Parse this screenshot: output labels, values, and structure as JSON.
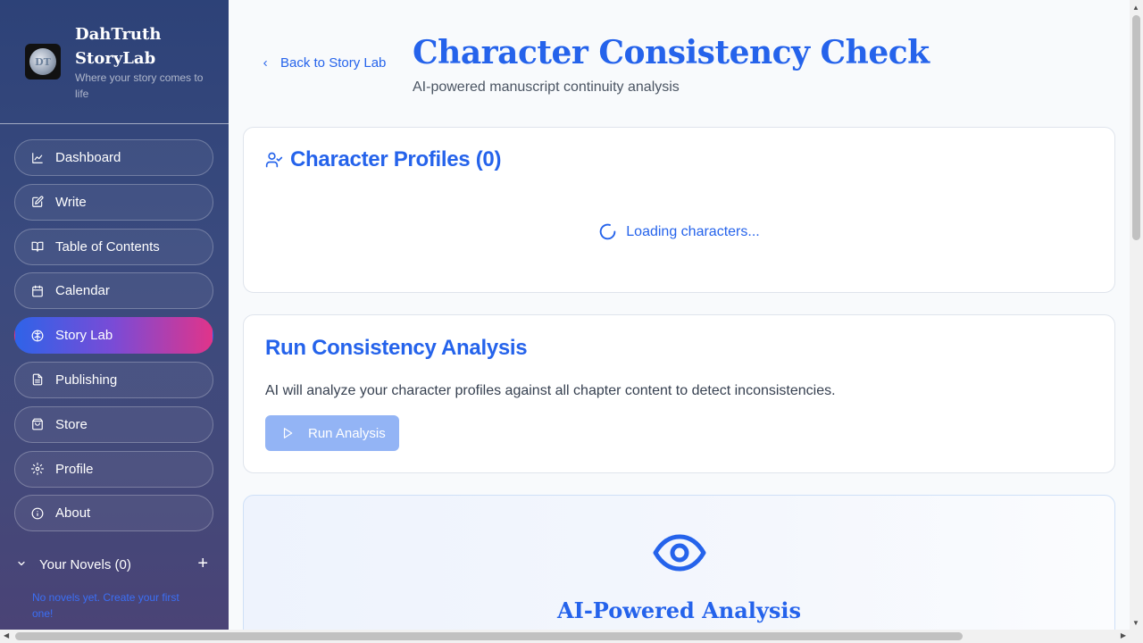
{
  "brand": {
    "name": "DahTruth StoryLab",
    "tagline": "Where your story comes to life",
    "logo_text": "DT"
  },
  "nav": {
    "items": [
      {
        "label": "Dashboard",
        "icon": "chart-line-icon"
      },
      {
        "label": "Write",
        "icon": "edit-icon"
      },
      {
        "label": "Table of Contents",
        "icon": "book-open-icon"
      },
      {
        "label": "Calendar",
        "icon": "calendar-icon"
      },
      {
        "label": "Story Lab",
        "icon": "brain-icon",
        "active": true
      },
      {
        "label": "Publishing",
        "icon": "document-icon"
      },
      {
        "label": "Store",
        "icon": "shopping-bag-icon"
      },
      {
        "label": "Profile",
        "icon": "gear-icon"
      },
      {
        "label": "About",
        "icon": "info-icon"
      }
    ]
  },
  "novels": {
    "header": "Your Novels (0)",
    "empty_text": "No novels yet. Create your first one!"
  },
  "header": {
    "back_label": "Back to Story Lab",
    "title": "Character Consistency Check",
    "subtitle": "AI-powered manuscript continuity analysis"
  },
  "profiles_card": {
    "title": "Character Profiles (0)",
    "loading_text": "Loading characters..."
  },
  "analysis_card": {
    "title": "Run Consistency Analysis",
    "description": "AI will analyze your character profiles against all chapter content to detect inconsistencies.",
    "button_label": "Run Analysis"
  },
  "info_card": {
    "title": "AI-Powered Analysis",
    "icon": "eye-icon"
  },
  "colors": {
    "accent": "#2563eb",
    "sidebar_top": "#2d4278",
    "active_gradient_start": "#2f63e8",
    "active_gradient_end": "#e0348a",
    "button_disabled": "#93b4f5"
  }
}
